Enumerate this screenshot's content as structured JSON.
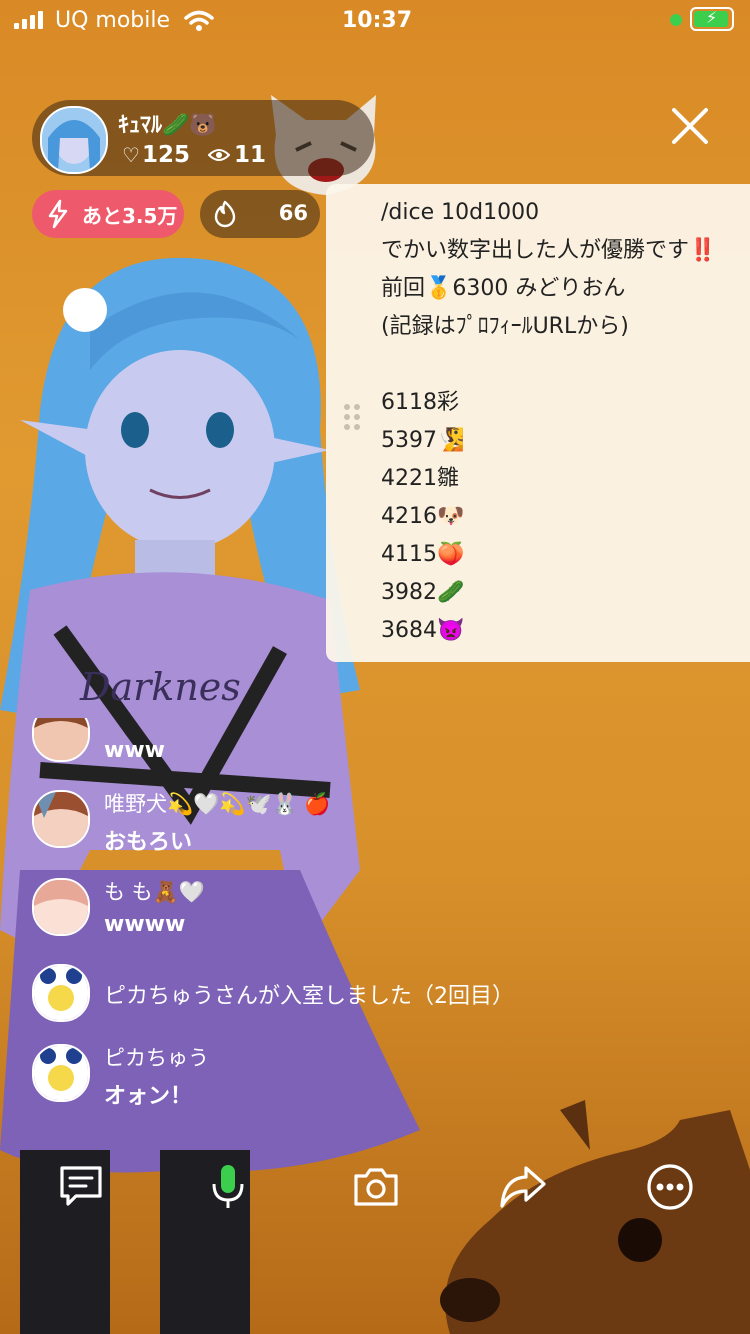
{
  "status_bar": {
    "carrier": "UQ mobile",
    "time": "10:37"
  },
  "host": {
    "name": "ｷｭﾏﾙ🥒🐻",
    "likes": "125",
    "viewers": "11"
  },
  "badges": {
    "remaining_label": "あと3.5万",
    "fire_count": "66"
  },
  "notice": {
    "lines": [
      "/dice 10d1000",
      "でかい数字出した人が優勝です‼️",
      "前回🥇6300 みどりおん",
      "(記録はﾌﾟﾛﾌｨｰﾙURLから)",
      "",
      "6118彩",
      "5397🧏",
      "4221雛",
      "4216🐶",
      "4115🍑",
      "3982🥒",
      "3684👿"
    ]
  },
  "comments": [
    {
      "name": "",
      "text": "www"
    },
    {
      "name": "唯野犬💫🤍💫🕊️🐰 🍎",
      "text": "おもろい"
    },
    {
      "name": "も も🧸🤍",
      "text": "wwww"
    },
    {
      "name": "ピカちゅうさんが入室しました（2回目）",
      "text": ""
    },
    {
      "name": "ピカちゅう",
      "text": "オォン！"
    }
  ],
  "toolbar": {
    "icons": [
      "comment-icon",
      "microphone-icon",
      "camera-icon",
      "share-icon",
      "more-icon"
    ]
  },
  "colors": {
    "accent_green": "#3ccf4e",
    "badge_red": "#ee5a6b"
  }
}
